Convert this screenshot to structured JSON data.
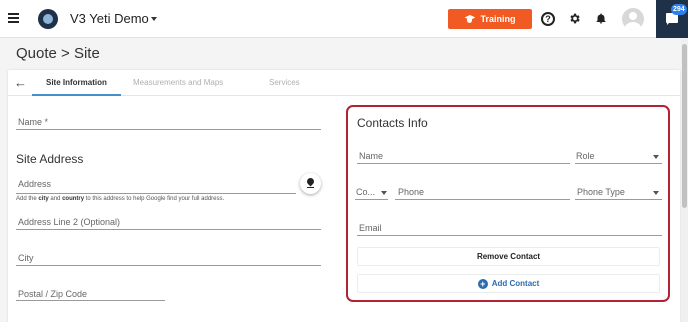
{
  "app": {
    "title": "V3 Yeti Demo"
  },
  "toolbar": {
    "training_label": "Training",
    "help_glyph": "?",
    "chat_badge": "294"
  },
  "page": {
    "breadcrumb": "Quote > Site"
  },
  "tabs": [
    {
      "label": "Site Information",
      "active": true
    },
    {
      "label": "Measurements and Maps",
      "active": false
    },
    {
      "label": "Services",
      "active": false
    }
  ],
  "site": {
    "name_placeholder": "Name *",
    "address_section_title": "Site Address",
    "address_placeholder": "Address",
    "address_hint_prefix": "Add the ",
    "address_hint_city": "city",
    "address_hint_and": " and ",
    "address_hint_country": "country",
    "address_hint_suffix": " to this address to help Google find your full address.",
    "address2_placeholder": "Address Line 2 (Optional)",
    "city_placeholder": "City",
    "postal_placeholder": "Postal / Zip Code"
  },
  "contacts": {
    "title": "Contacts Info",
    "name_placeholder": "Name",
    "role_placeholder": "Role",
    "country_code_placeholder": "Co...",
    "phone_placeholder": "Phone",
    "phone_type_placeholder": "Phone Type",
    "email_placeholder": "Email",
    "remove_label": "Remove Contact",
    "add_label": "Add Contact"
  },
  "colors": {
    "training": "#f15a22",
    "navy": "#1f3148",
    "highlight_border": "#b22234",
    "link_blue": "#2b6cb0",
    "tab_indicator": "#4a90c8"
  },
  "icons": [
    "menu-icon",
    "app-logo-icon",
    "graduation-cap-icon",
    "help-icon",
    "gear-icon",
    "bell-icon",
    "avatar",
    "chat-icon",
    "back-arrow-icon",
    "map-pin-icon",
    "plus-circle-icon"
  ]
}
